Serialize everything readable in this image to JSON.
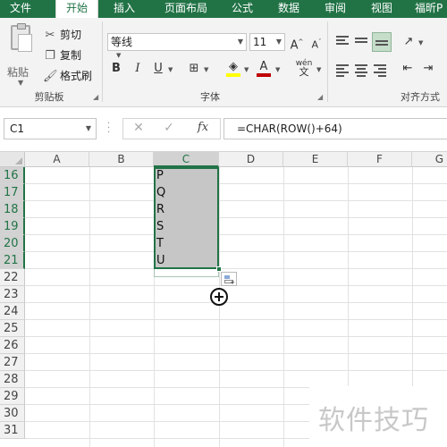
{
  "tabs": [
    "文件",
    "开始",
    "插入",
    "页面布局",
    "公式",
    "数据",
    "审阅",
    "视图",
    "福昕P"
  ],
  "ribbon": {
    "clipboard": {
      "paste_label": "粘贴",
      "cut_label": "剪切",
      "copy_label": "复制",
      "format_painter_label": "格式刷",
      "group_label": "剪贴板"
    },
    "font": {
      "font_name": "等线",
      "font_size": "11",
      "bold": "B",
      "italic": "I",
      "underline": "U",
      "grow": "A",
      "shrink": "A",
      "wen": "wén",
      "font_color_letter": "A",
      "group_label": "字体"
    },
    "alignment": {
      "group_label": "对齐方式"
    }
  },
  "formula_bar": {
    "name_box": "C1",
    "cancel": "✕",
    "enter": "✓",
    "fx": "fx",
    "formula": "=CHAR(ROW()+64)"
  },
  "grid": {
    "columns": [
      "A",
      "B",
      "C",
      "D",
      "E",
      "F",
      "G"
    ],
    "selected_column": "C",
    "rows": [
      "16",
      "17",
      "18",
      "19",
      "20",
      "21",
      "22",
      "23",
      "24",
      "25",
      "26",
      "27",
      "28",
      "29",
      "30",
      "31"
    ],
    "selected_rows": [
      "16",
      "17",
      "18",
      "19",
      "20",
      "21"
    ],
    "cells_c": [
      "P",
      "Q",
      "R",
      "S",
      "T",
      "U"
    ]
  },
  "watermark": "软件技巧",
  "colors": {
    "accent": "#217346",
    "selection": "#c6c6c6",
    "font_color_bar": "#c00000",
    "highlight_bar": "#ffff00"
  }
}
